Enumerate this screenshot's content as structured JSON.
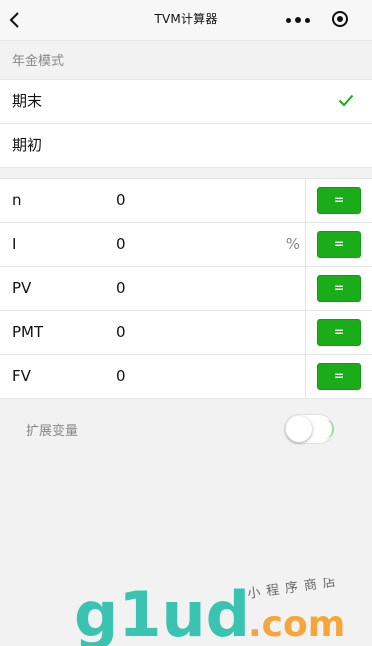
{
  "nav": {
    "title": "TVM计算器"
  },
  "mode_section": {
    "header": "年金模式",
    "options": [
      {
        "label": "期末",
        "selected": true
      },
      {
        "label": "期初",
        "selected": false
      }
    ]
  },
  "tvm_rows": [
    {
      "label": "n",
      "value": "0",
      "unit": "",
      "button": "="
    },
    {
      "label": "I",
      "value": "0",
      "unit": "%",
      "button": "="
    },
    {
      "label": "PV",
      "value": "0",
      "unit": "",
      "button": "="
    },
    {
      "label": "PMT",
      "value": "0",
      "unit": "",
      "button": "="
    },
    {
      "label": "FV",
      "value": "0",
      "unit": "",
      "button": "="
    }
  ],
  "extend": {
    "label": "扩展变量",
    "enabled": false
  },
  "watermark": {
    "logo_text": "g1ud",
    "suffix": ".com",
    "tagline": "小程序商店"
  },
  "colors": {
    "accent": "#1aad19",
    "watermark_teal": "#39c3b0",
    "watermark_green": "#8cc63e",
    "watermark_orange": "#f7a53b"
  }
}
